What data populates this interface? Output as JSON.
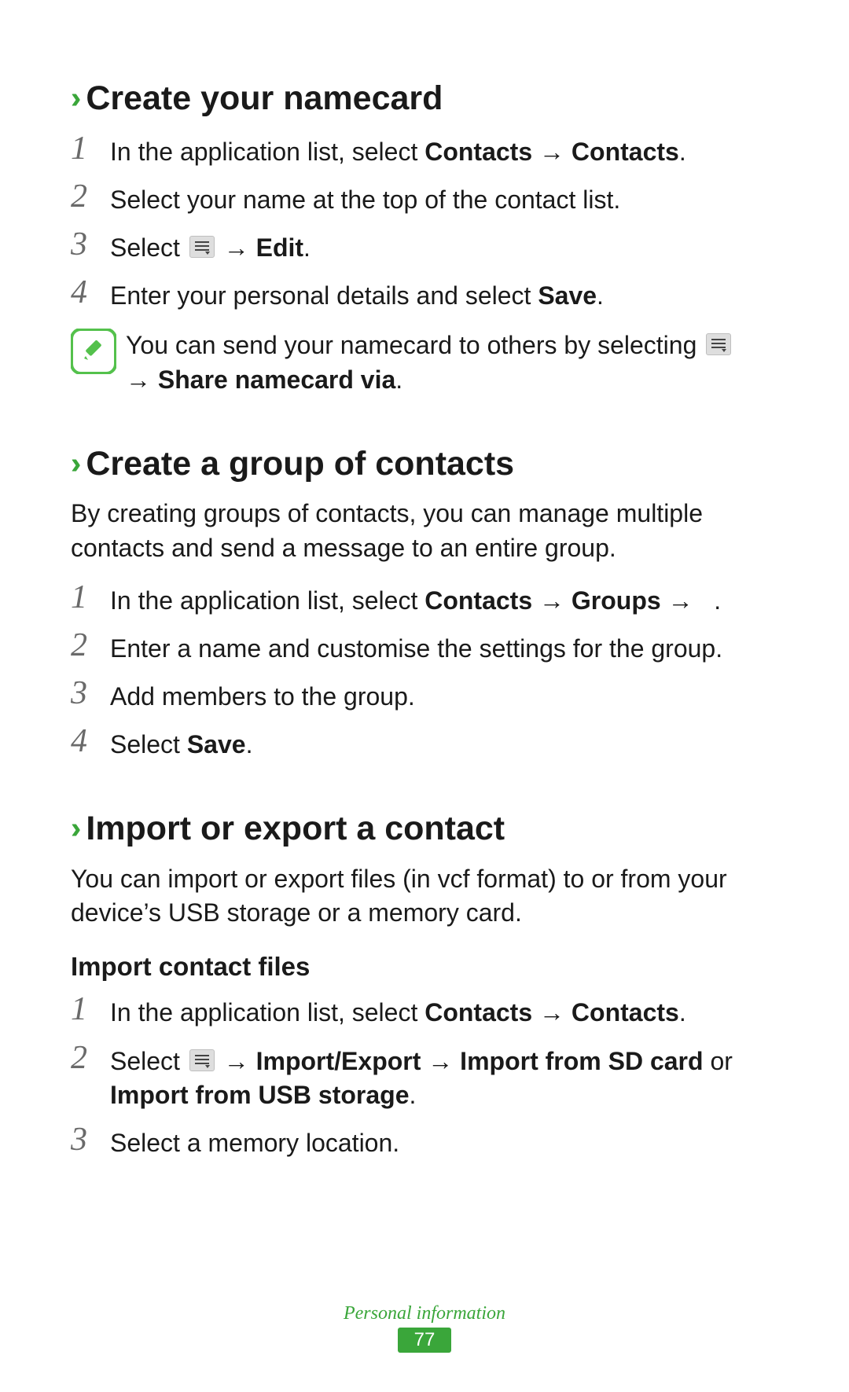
{
  "sections": {
    "namecard": {
      "chevrons": "››",
      "title": "Create your namecard",
      "steps": {
        "s1": {
          "num": "1",
          "pre": "In the application list, select ",
          "b": "Contacts → Contacts",
          "post": "."
        },
        "s2": {
          "num": "2",
          "text": "Select your name at the top of the contact list."
        },
        "s3": {
          "num": "3",
          "pre": "Select ",
          "post_pre": " → ",
          "b": "Edit",
          "post": "."
        },
        "s4": {
          "num": "4",
          "pre": "Enter your personal details and select ",
          "b": "Save",
          "post": "."
        }
      },
      "note": {
        "line1": "You can send your namecard to others by selecting ",
        "line2_pre": "→ ",
        "line2_b": "Share namecard via",
        "line2_post": "."
      }
    },
    "group": {
      "chevrons": "››",
      "title": "Create a group of contacts",
      "intro": "By creating groups of contacts, you can manage multiple contacts and send a message to an entire group.",
      "steps": {
        "s1": {
          "num": "1",
          "pre": "In the application list, select ",
          "b": "Contacts → Groups →",
          "post": "   ."
        },
        "s2": {
          "num": "2",
          "text": "Enter a name and customise the settings for the group."
        },
        "s3": {
          "num": "3",
          "text": "Add members to the group."
        },
        "s4": {
          "num": "4",
          "pre": "Select ",
          "b": "Save",
          "post": "."
        }
      }
    },
    "import": {
      "chevrons": "››",
      "title": "Import or export a contact",
      "intro": "You can import or export files (in vcf format) to or from your device’s USB storage or a memory card.",
      "sub": "Import contact files",
      "steps": {
        "s1": {
          "num": "1",
          "pre": "In the application list, select ",
          "b": "Contacts → Contacts",
          "post": "."
        },
        "s2": {
          "num": "2",
          "pre": "Select ",
          "post_pre": " → ",
          "b": "Import/Export → Import from SD card",
          "mid": " or ",
          "b2": "Import from USB storage",
          "post": "."
        },
        "s3": {
          "num": "3",
          "text": "Select a memory location."
        }
      }
    }
  },
  "footer": {
    "label": "Personal information",
    "page": "77"
  }
}
